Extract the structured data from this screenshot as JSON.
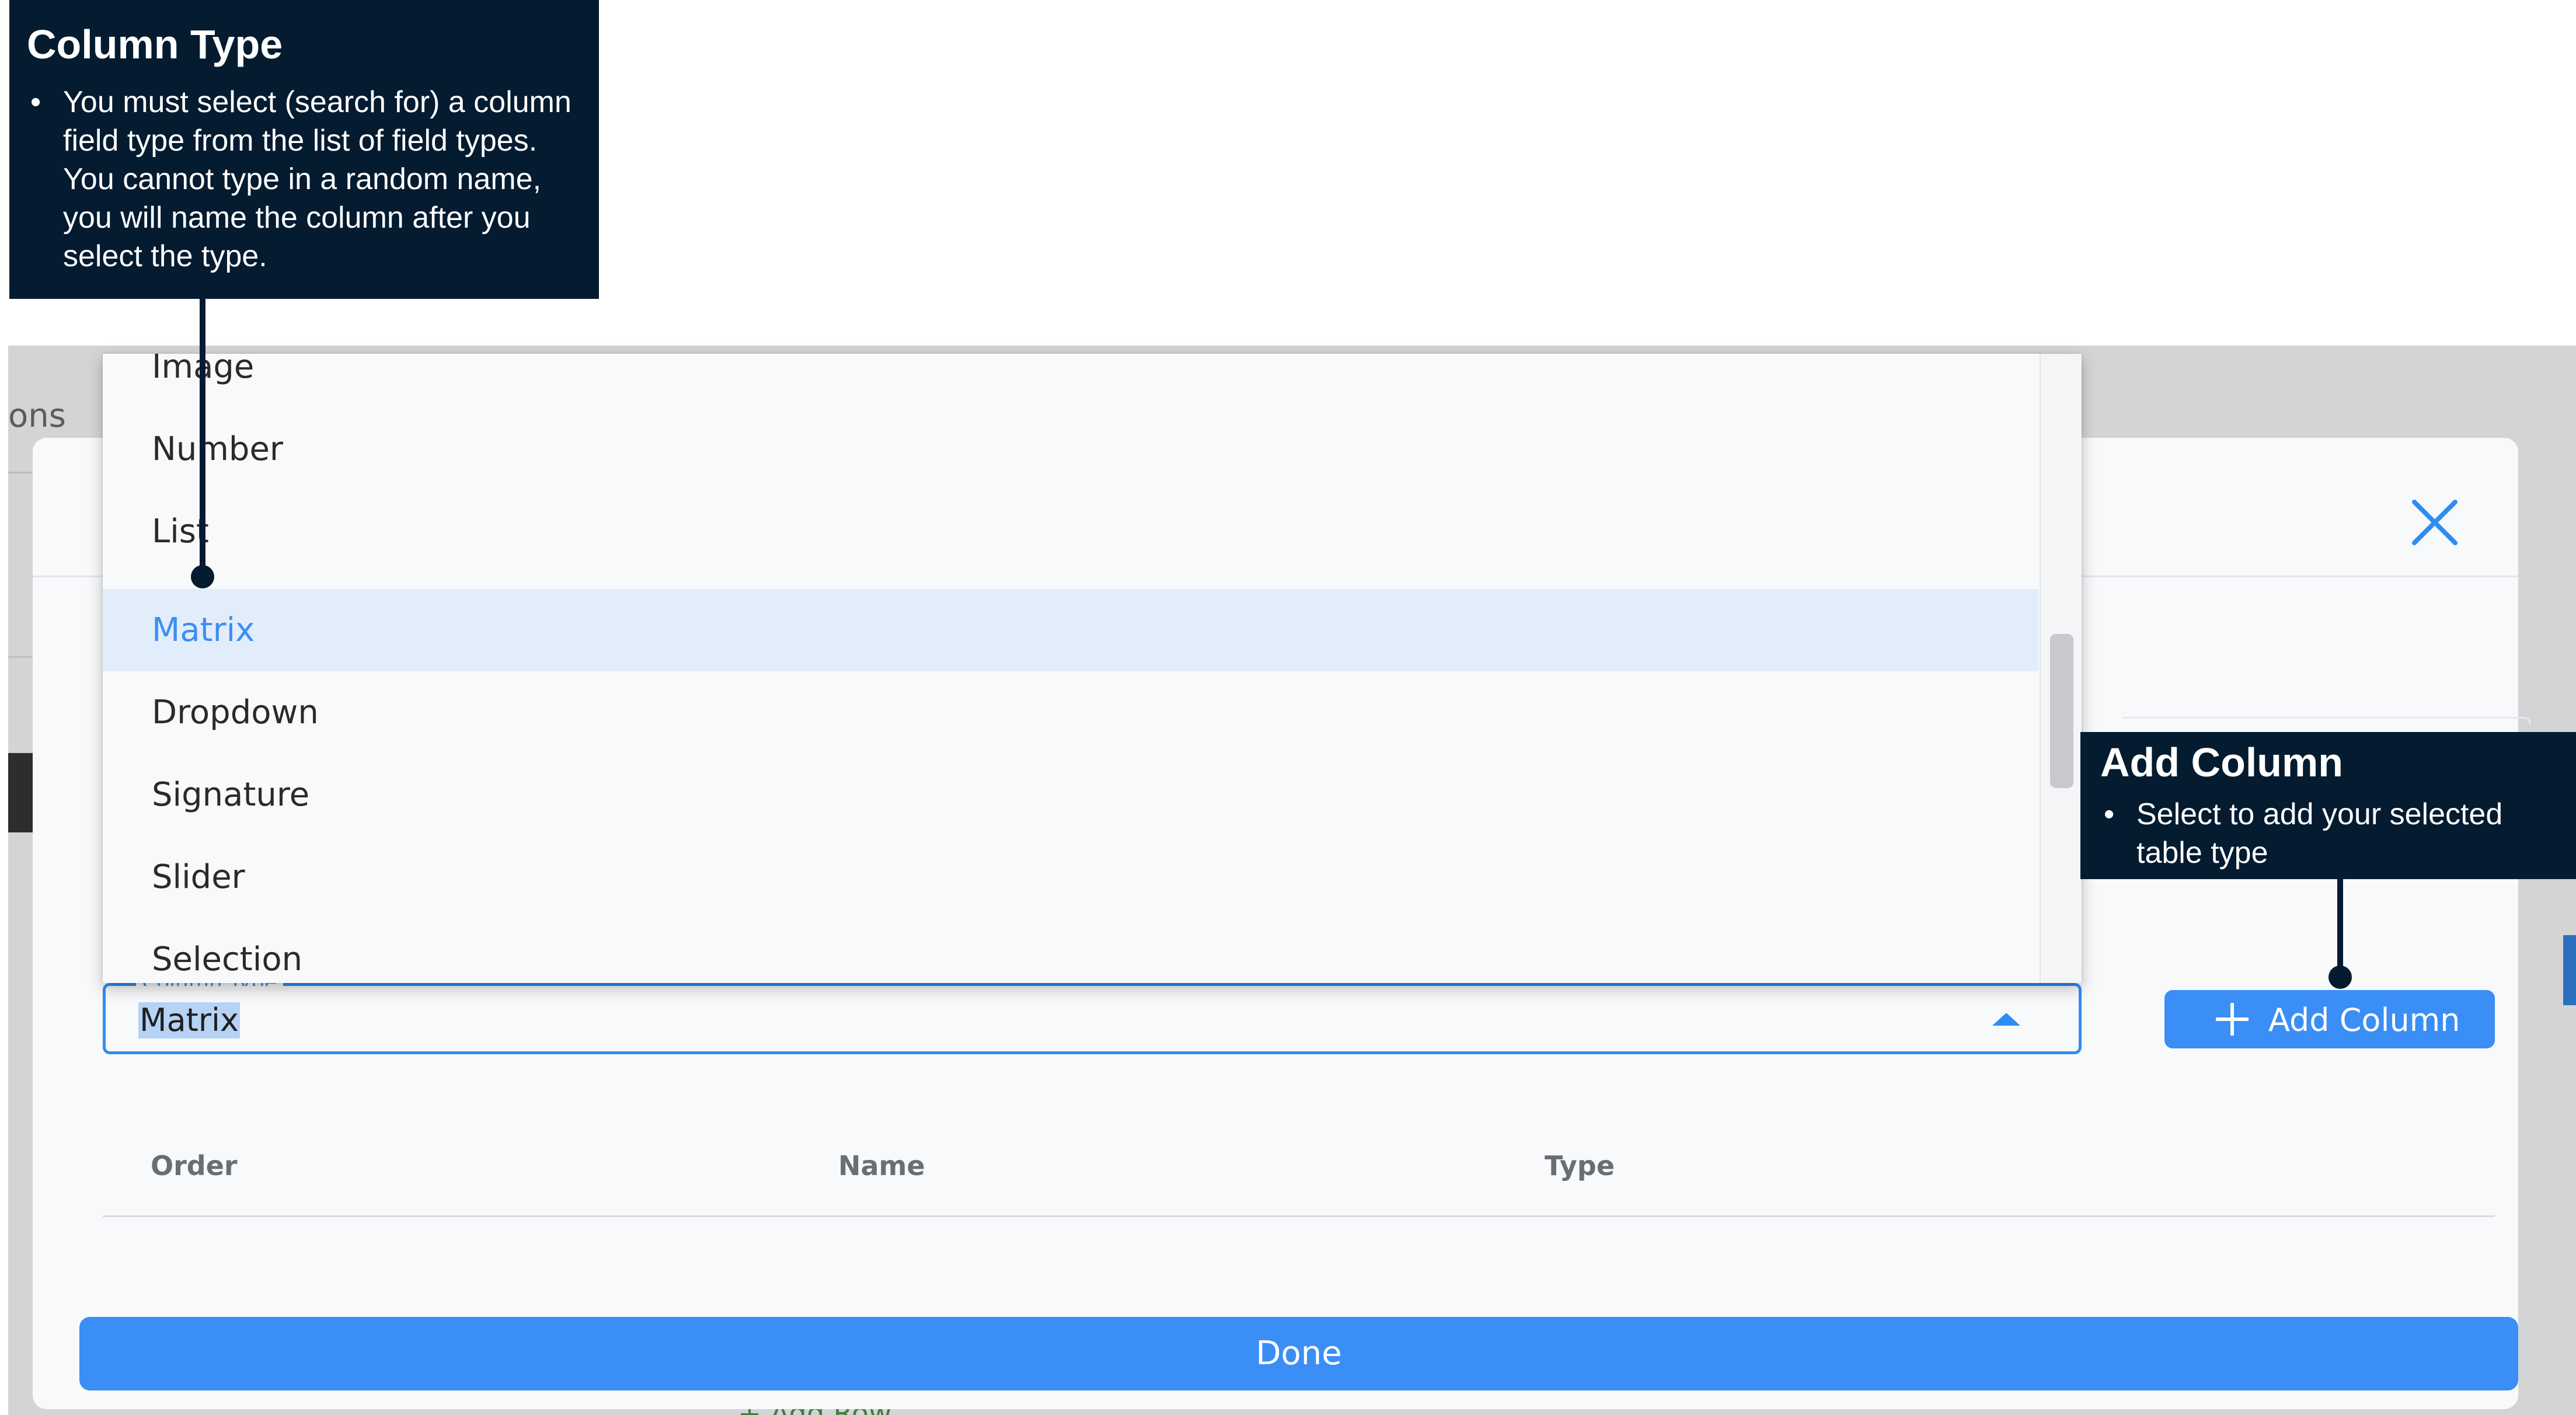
{
  "background": {
    "tab_fragment": "ons",
    "add_row_fragment": "+ Add Row"
  },
  "dialog": {
    "dropdown_options": [
      {
        "label": "Image",
        "selected": false
      },
      {
        "label": "Number",
        "selected": false
      },
      {
        "label": "List",
        "selected": false
      },
      {
        "label": "Matrix",
        "selected": true
      },
      {
        "label": "Dropdown",
        "selected": false
      },
      {
        "label": "Signature",
        "selected": false
      },
      {
        "label": "Slider",
        "selected": false
      },
      {
        "label": "Selection",
        "selected": false
      }
    ],
    "column_type_label": "Column Type",
    "column_type_value": "Matrix",
    "add_column_label": "Add Column",
    "table_headers": [
      "Order",
      "Name",
      "Type"
    ],
    "done_label": "Done",
    "close_icon": "close-icon"
  },
  "callouts": {
    "column_type": {
      "title": "Column Type",
      "bullet": "You must select (search for) a column field type from the list of field types. You cannot type in a random name, you will name the column after you select the type."
    },
    "add_column": {
      "title": "Add Column",
      "bullet": "Select to add your selected table type"
    }
  },
  "colors": {
    "accent": "#3a8ef6",
    "callout_bg": "#041b30",
    "selected_option_bg": "#e2edfb"
  }
}
